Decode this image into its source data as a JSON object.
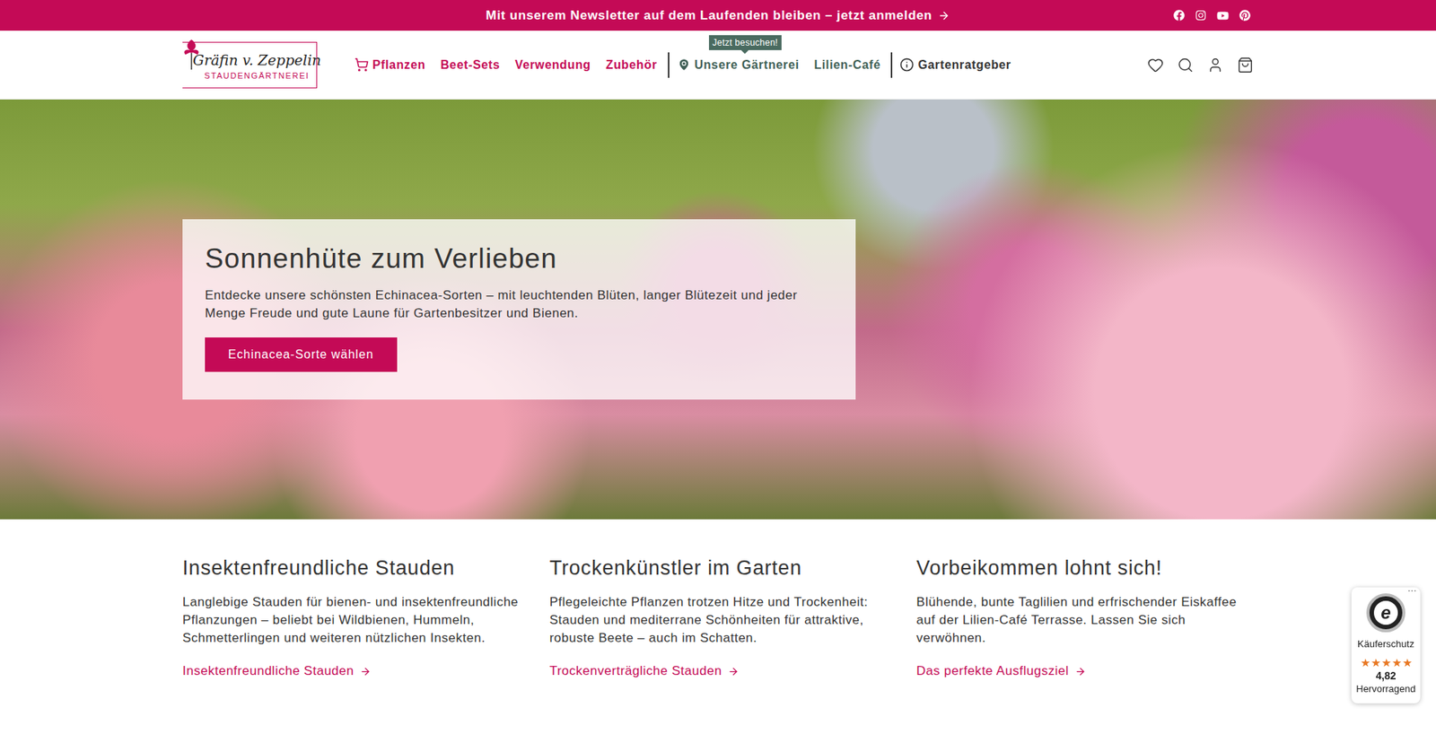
{
  "announcement": {
    "text": "Mit unserem Newsletter auf dem Laufenden bleiben – jetzt anmelden"
  },
  "logo": {
    "script": "Gräfin v. Zeppelin",
    "subtitle": "STAUDENGÄRTNEREI"
  },
  "nav": {
    "shop": [
      {
        "label": "Pflanzen",
        "icon": true
      },
      {
        "label": "Beet-Sets",
        "icon": false
      },
      {
        "label": "Verwendung",
        "icon": false
      },
      {
        "label": "Zubehör",
        "icon": false
      }
    ],
    "visit": [
      {
        "label": "Unsere Gärtnerei",
        "icon": true,
        "tooltip": "Jetzt besuchen!"
      },
      {
        "label": "Lilien-Café",
        "icon": false,
        "tooltip": ""
      }
    ],
    "guide": {
      "label": "Gartenratgeber"
    }
  },
  "hero": {
    "title": "Sonnenhüte zum Verlieben",
    "text": "Entdecke unsere schönsten Echinacea-Sorten – mit leuchtenden Blüten, langer Blütezeit und jeder Menge Freude und gute Laune für Gartenbesitzer und Bienen.",
    "button": "Echinacea-Sorte wählen"
  },
  "features": [
    {
      "title": "Insektenfreundliche Stauden",
      "text": "Langlebige Stauden für bienen- und insektenfreundliche Pflanzungen – beliebt bei Wildbienen, Hummeln, Schmetterlingen und weiteren nützlichen Insekten.",
      "link": "Insektenfreundliche Stauden"
    },
    {
      "title": "Trockenkünstler im Garten",
      "text": "Pflegeleichte Pflanzen trotzen Hitze und Trockenheit: Stauden und mediterrane Schönheiten für attraktive, robuste Beete – auch im Schatten.",
      "link": "Trockenverträgliche Stauden"
    },
    {
      "title": "Vorbeikommen lohnt sich!",
      "text": "Blühende, bunte Taglilien und erfrischender Eiskaffee auf der Lilien-Café Terrasse. Lassen Sie sich verwöhnen.",
      "link": "Das perfekte Ausflugsziel"
    }
  ],
  "trust_badge": {
    "mark": "e",
    "more": "···",
    "label": "Käuferschutz",
    "stars": 5,
    "score": "4,82",
    "rating": "Hervorragend"
  }
}
